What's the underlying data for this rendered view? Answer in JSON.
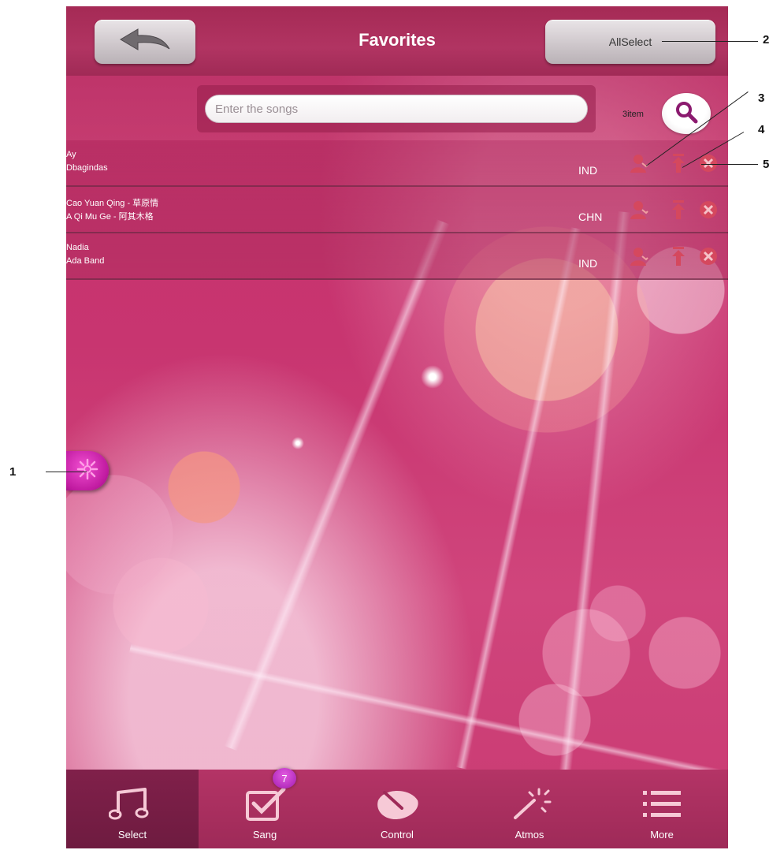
{
  "header": {
    "back_icon": "back-arrow-icon",
    "title": "Favorites",
    "allselect_label": "AllSelect"
  },
  "search": {
    "placeholder": "Enter the songs",
    "item_count": "3item",
    "search_icon": "magnifier-icon"
  },
  "songs": [
    {
      "title": "Ay",
      "artist": "Dbagindas",
      "language": "IND"
    },
    {
      "title": "Cao Yuan Qing - 草原情",
      "artist": "A Qi Mu Ge - 阿其木格",
      "language": "CHN"
    },
    {
      "title": "Nadia",
      "artist": "Ada Band",
      "language": "IND"
    }
  ],
  "row_icons": [
    "singer-icon",
    "move-to-top-icon",
    "delete-icon"
  ],
  "side_button_icon": "gear-icon",
  "tabs": [
    {
      "label": "Select",
      "icon": "music-note-icon",
      "active": true
    },
    {
      "label": "Sang",
      "icon": "checklist-icon",
      "badge": "7"
    },
    {
      "label": "Control",
      "icon": "control-icon"
    },
    {
      "label": "Atmos",
      "icon": "magic-wand-icon"
    },
    {
      "label": "More",
      "icon": "list-icon"
    }
  ],
  "callouts": [
    "1",
    "2",
    "3",
    "4",
    "5"
  ],
  "colors": {
    "header": "#a52a55",
    "background": "#c83570",
    "tab_bar": "#9e2a58",
    "tab_active": "#6e1b40",
    "icon_red": "#d5485e",
    "badge": "#c43ac8"
  }
}
